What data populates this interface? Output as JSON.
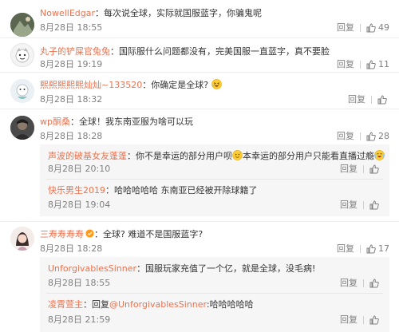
{
  "actions": {
    "reply_label": "回复"
  },
  "comments": [
    {
      "user": "NowellEdgar",
      "text": "：每次说全球，实际就国服蓝字，你骗鬼呢",
      "time": "8月28日 18:55",
      "likes": "49"
    },
    {
      "user": "丸子的铲屎官兔兔",
      "text": "：国际服什么问题都没有，完美国服一直蓝字，真不要脸",
      "time": "8月28日 19:19",
      "likes": "11"
    },
    {
      "user": "熙熙熙熙熙灿灿~133520",
      "text": "：你确定是全球?",
      "time": "8月28日 18:32",
      "likes": ""
    },
    {
      "user": "wp酮桑",
      "text": "：全球！我东南亚服为啥可以玩",
      "time": "8月28日 18:28",
      "likes": "28",
      "replies": [
        {
          "user": "声波的破基女友蓬蓬",
          "text_a": "：你不是幸运的部分用户呗",
          "text_b": "本幸运的部分用户只能看直播过瘾",
          "time": "8月28日 20:10",
          "likes": ""
        },
        {
          "user": "快乐男生2019",
          "text": "：哈哈哈哈哈  东南亚已经被开除球籍了",
          "time": "8月28日 19:04",
          "likes": ""
        }
      ]
    },
    {
      "user": "三寿寿寿寿",
      "text": "：全球? 难道不是国服蓝字?",
      "time": "8月28日 18:28",
      "likes": "17",
      "replies": [
        {
          "user": "UnforgivablesSinner",
          "text": "：国服玩家充值了一个亿，就是全球，没毛病!",
          "time": "8月28日 18:55",
          "likes": ""
        },
        {
          "user": "凌霄萱主",
          "text_a": "：回复",
          "mention": "@UnforgivablesSinner",
          "text_b": ":哈哈哈哈哈",
          "time": "8月28日 21:59",
          "likes": ""
        }
      ]
    }
  ]
}
